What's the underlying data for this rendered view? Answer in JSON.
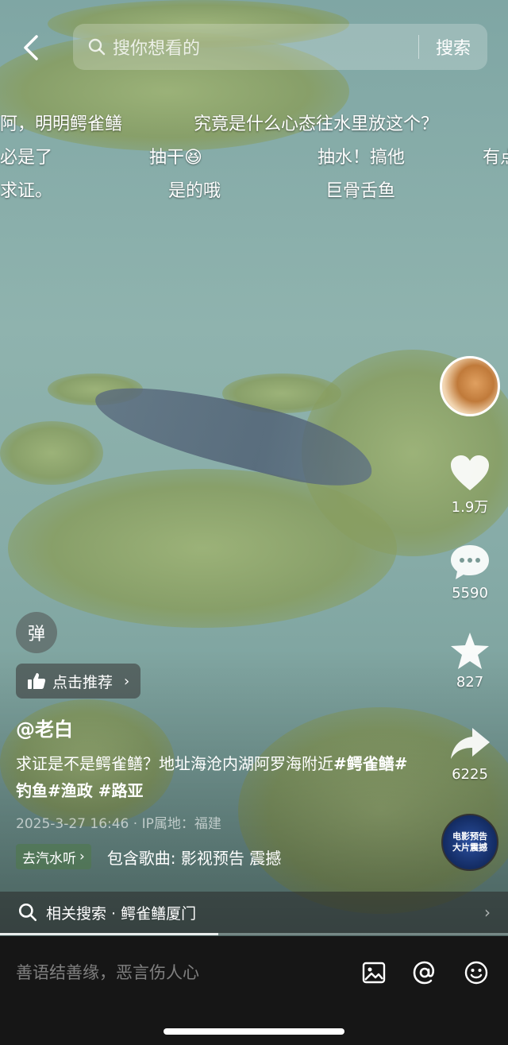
{
  "search": {
    "placeholder": "搜你想看的",
    "button": "搜索"
  },
  "danmaku": [
    "阿，明明鳄雀鳝",
    "究竟是什么心态往水里放这个？",
    "必是了",
    "抽干😆",
    "抽水！搞他",
    "有点",
    "求证。",
    "是的哦",
    "巨骨舌鱼"
  ],
  "rail": {
    "likes": "1.9万",
    "comments": "5590",
    "favorites": "827",
    "shares": "6225",
    "music_disc_lines": [
      "电影预告",
      "大片震撼"
    ]
  },
  "danmu_toggle": "弹",
  "recommend": "点击推荐",
  "author": "@老白",
  "description": {
    "text": "求证是不是鳄雀鳝？地址海沧内湖阿罗海附近",
    "tags": "#鳄雀鳝#钓鱼#渔政 #路亚"
  },
  "meta": "2025-3-27 16:46 · IP属地：福建",
  "music": {
    "qishui": "去汽水听",
    "song": "包含歌曲: 影视预告 震撼"
  },
  "related": {
    "label": "相关搜索 · 鳄雀鳝厦门"
  },
  "progress": 0.43,
  "comment_placeholder": "善语结善缘，恶言伤人心"
}
